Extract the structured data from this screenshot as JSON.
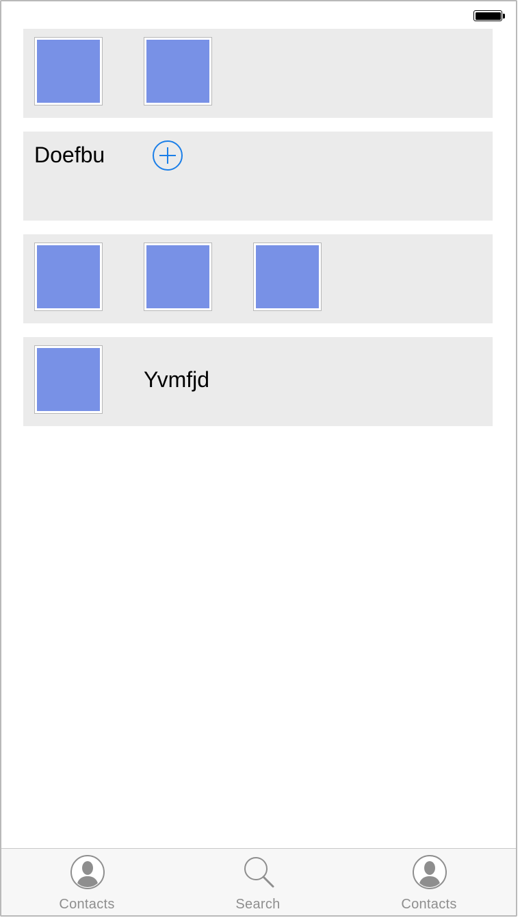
{
  "status_bar": {
    "battery_icon": "battery-full-icon",
    "battery_level": 1.0
  },
  "cards": [
    {
      "type": "thumbnails",
      "thumbnail_count": 2
    },
    {
      "type": "title-with-add",
      "title": "Doefbu",
      "add_icon": "plus-circle-icon"
    },
    {
      "type": "thumbnails",
      "thumbnail_count": 3
    },
    {
      "type": "thumbnail-with-label",
      "label": "Yvmfjd"
    }
  ],
  "colors": {
    "card_background": "#ebebeb",
    "thumbnail_fill": "#7891e6",
    "accent": "#1a7ee8",
    "tab_inactive": "#8e8e8e"
  },
  "tab_bar": {
    "tabs": [
      {
        "label": "Contacts",
        "icon": "person-icon"
      },
      {
        "label": "Search",
        "icon": "magnifier-icon"
      },
      {
        "label": "Contacts",
        "icon": "person-icon"
      }
    ]
  }
}
